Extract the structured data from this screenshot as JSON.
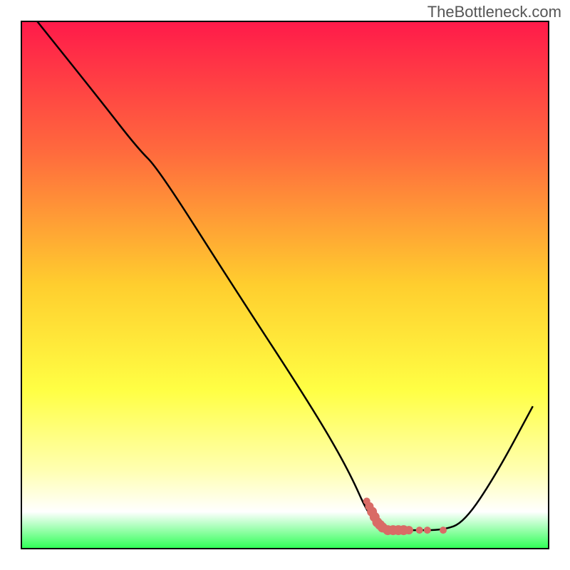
{
  "watermark": "TheBottleneck.com",
  "chart_data": {
    "type": "line",
    "title": "",
    "xlabel": "",
    "ylabel": "",
    "xlim": [
      0,
      100
    ],
    "ylim": [
      0,
      100
    ],
    "background_gradient": {
      "stops": [
        {
          "offset": 0,
          "color": "#ff1a4a"
        },
        {
          "offset": 25,
          "color": "#ff6b3d"
        },
        {
          "offset": 50,
          "color": "#ffce2e"
        },
        {
          "offset": 70,
          "color": "#ffff44"
        },
        {
          "offset": 85,
          "color": "#ffffb0"
        },
        {
          "offset": 93,
          "color": "#ffffff"
        },
        {
          "offset": 100,
          "color": "#2eff55"
        }
      ]
    },
    "border_color": "#000000",
    "series": [
      {
        "name": "bottleneck-curve",
        "color": "#000000",
        "points": [
          {
            "x": 3,
            "y": 100
          },
          {
            "x": 15,
            "y": 85
          },
          {
            "x": 22,
            "y": 76
          },
          {
            "x": 26,
            "y": 72
          },
          {
            "x": 40,
            "y": 50
          },
          {
            "x": 55,
            "y": 27
          },
          {
            "x": 62,
            "y": 15
          },
          {
            "x": 66,
            "y": 6
          },
          {
            "x": 69,
            "y": 3.5
          },
          {
            "x": 74,
            "y": 3.5
          },
          {
            "x": 80,
            "y": 3.5
          },
          {
            "x": 84,
            "y": 5
          },
          {
            "x": 90,
            "y": 14
          },
          {
            "x": 97,
            "y": 27
          }
        ]
      }
    ],
    "annotations": [
      {
        "name": "marker-cluster",
        "color": "#d96b66",
        "points": [
          {
            "x": 65.5,
            "y": 9,
            "r": 5
          },
          {
            "x": 66,
            "y": 8,
            "r": 6
          },
          {
            "x": 66.5,
            "y": 7,
            "r": 7
          },
          {
            "x": 67,
            "y": 6,
            "r": 7
          },
          {
            "x": 67.5,
            "y": 5,
            "r": 7
          },
          {
            "x": 68,
            "y": 4.5,
            "r": 7
          },
          {
            "x": 68.5,
            "y": 4,
            "r": 7
          },
          {
            "x": 69.5,
            "y": 3.5,
            "r": 7
          },
          {
            "x": 70.5,
            "y": 3.5,
            "r": 7
          },
          {
            "x": 71.5,
            "y": 3.5,
            "r": 7
          },
          {
            "x": 72.5,
            "y": 3.5,
            "r": 7
          },
          {
            "x": 73.5,
            "y": 3.5,
            "r": 6
          },
          {
            "x": 75.5,
            "y": 3.5,
            "r": 5
          },
          {
            "x": 77,
            "y": 3.5,
            "r": 5
          },
          {
            "x": 80,
            "y": 3.5,
            "r": 5
          }
        ]
      }
    ]
  }
}
